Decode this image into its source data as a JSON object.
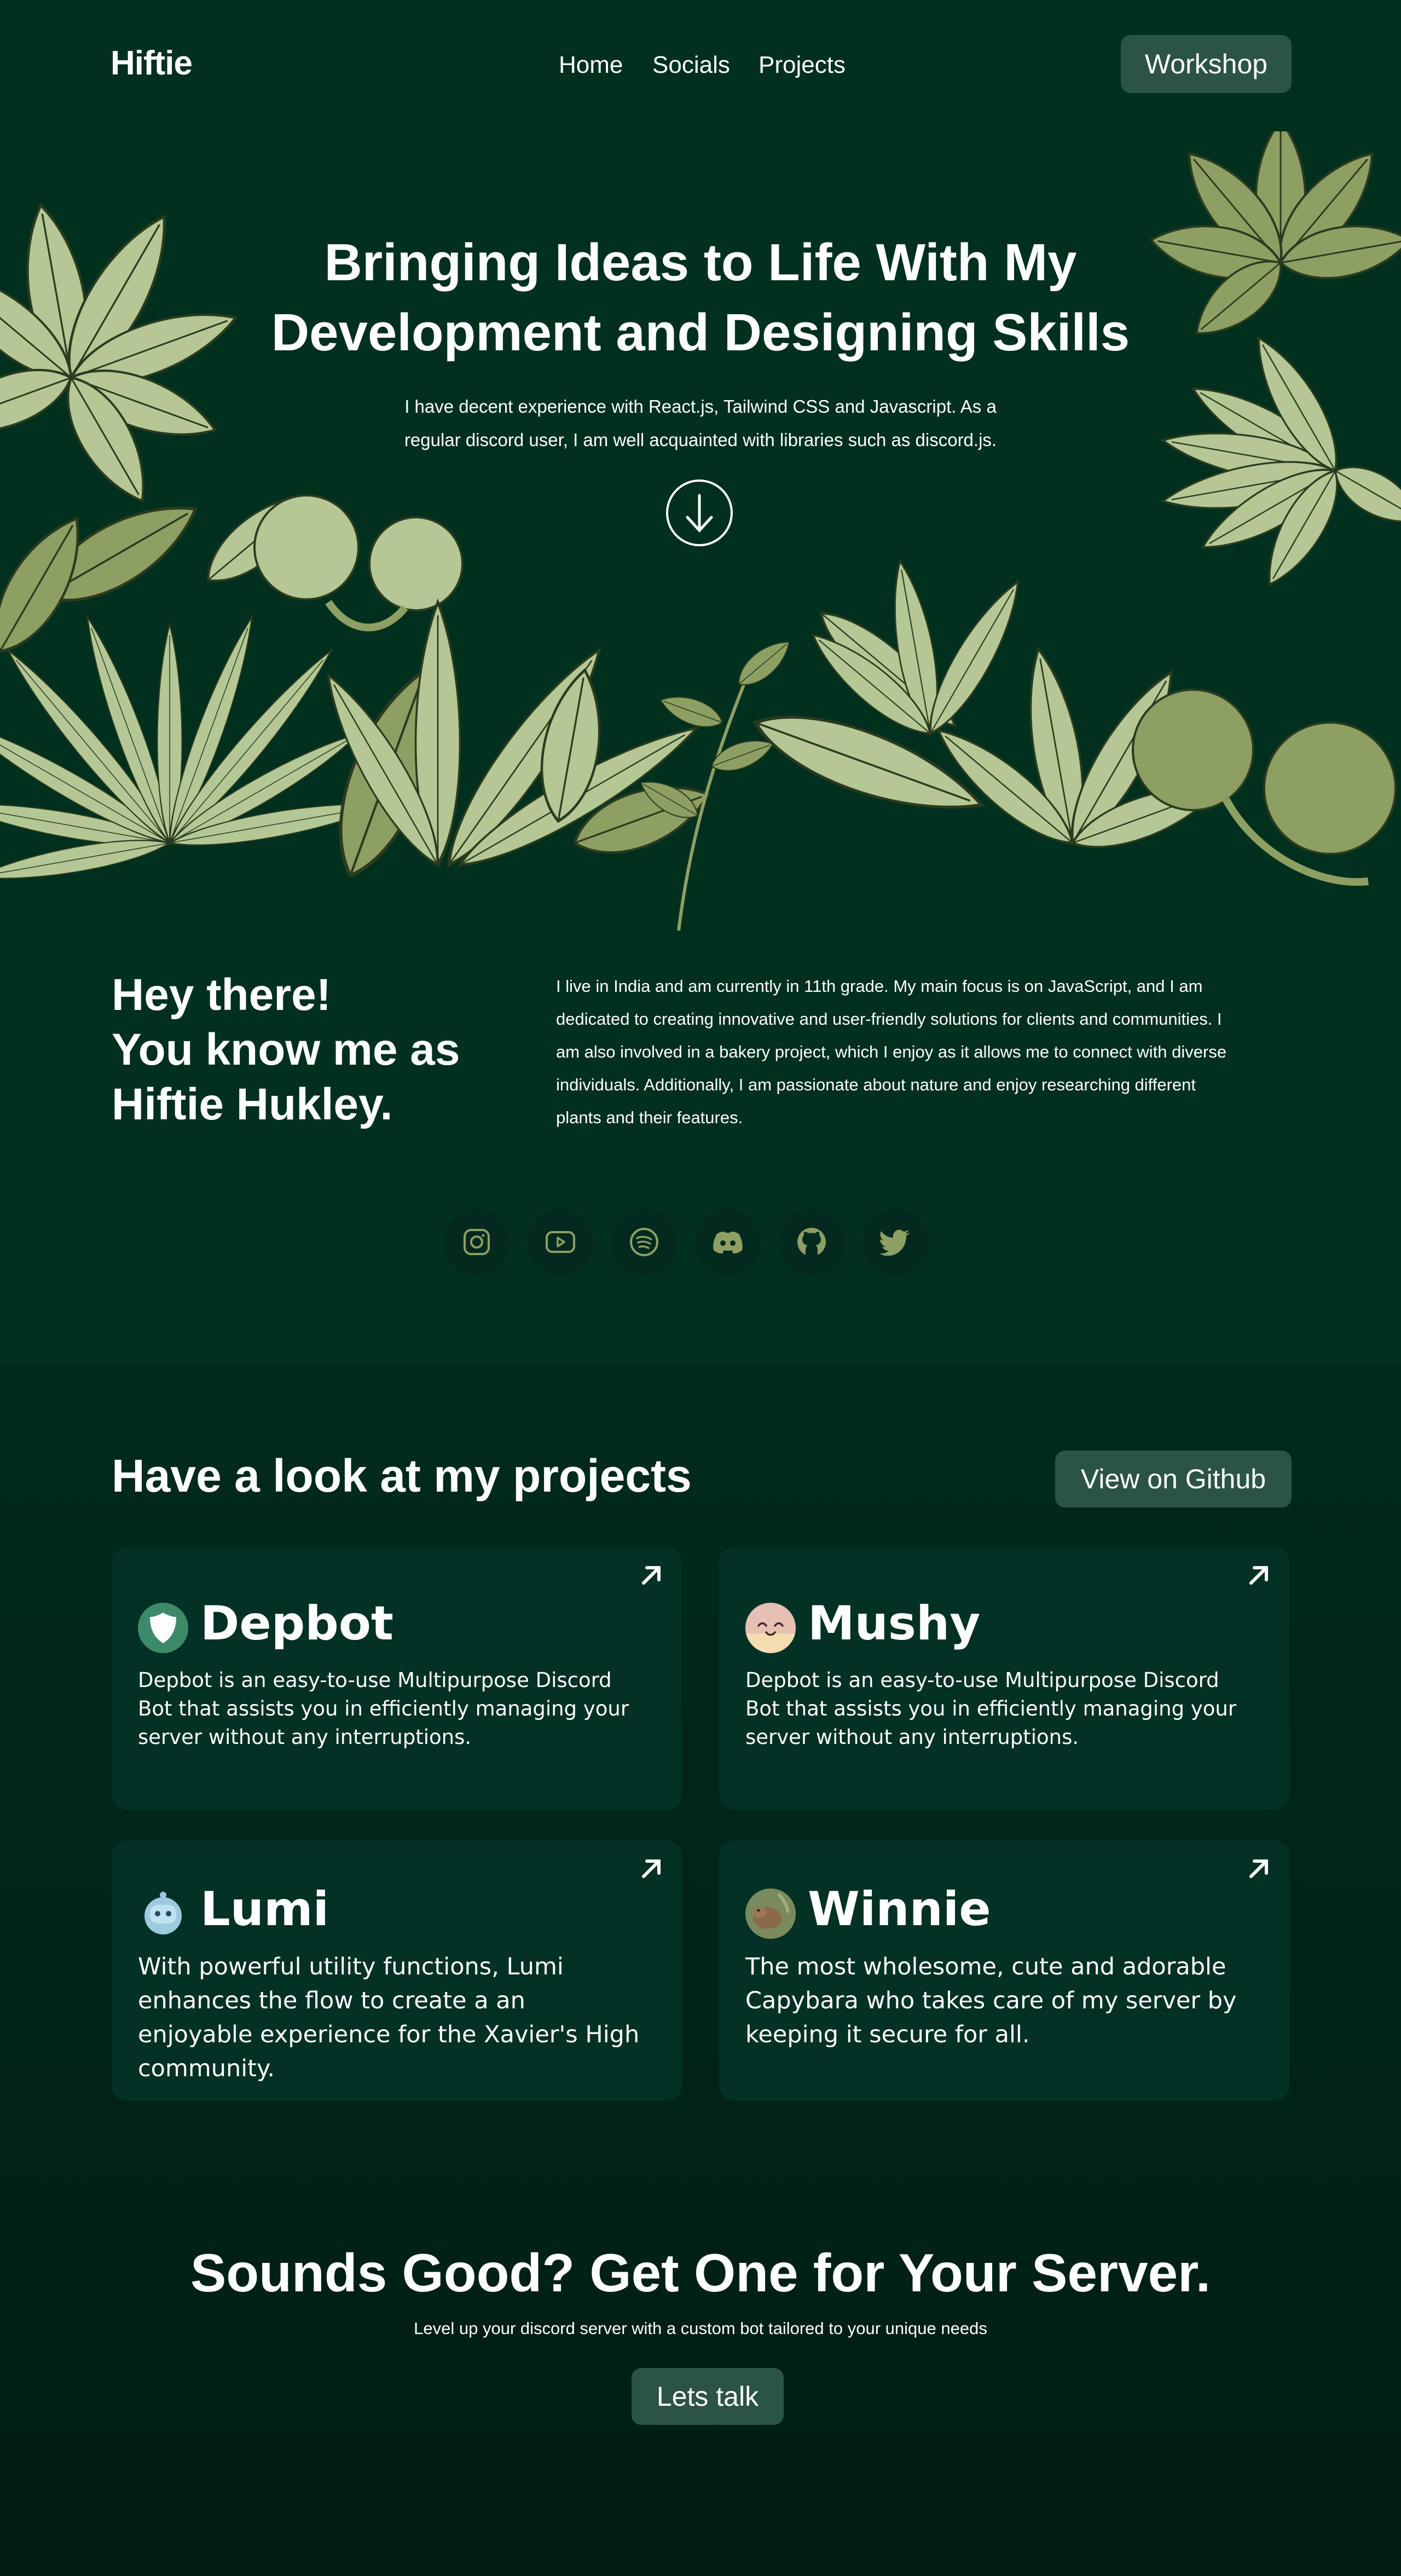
{
  "nav": {
    "logo": "Hiftie",
    "links": [
      "Home",
      "Socials",
      "Projects"
    ],
    "workshop_label": "Workshop"
  },
  "hero": {
    "title_line1": "Bringing Ideas to Life With My",
    "title_line2": "Development and Designing Skills",
    "subtitle_line1": "I have decent experience with React.js, Tailwind CSS and Javascript. As a",
    "subtitle_line2": "regular discord user, I am well acquainted with libraries such as discord.js.",
    "scroll_icon": "arrow-down-circle-icon"
  },
  "about": {
    "heading_line1": "Hey there!",
    "heading_line2": "You know me as",
    "heading_line3": "Hiftie Hukley.",
    "text_lines": [
      "I live in India and am currently in 11th grade. My main focus is on JavaScript, and I am",
      "dedicated to creating innovative and user-friendly solutions for clients and communities. I",
      "am also involved in a bakery project, which I enjoy as it allows me to connect with diverse",
      "individuals. Additionally, I am passionate about nature and enjoy researching different",
      "plants and their features."
    ],
    "socials": [
      "instagram-icon",
      "youtube-icon",
      "spotify-icon",
      "discord-icon",
      "github-icon",
      "twitter-icon"
    ]
  },
  "projects": {
    "heading": "Have a look at my projects",
    "github_label": "View on Github",
    "cards": [
      {
        "name": "Depbot",
        "desc": "Depbot is an easy-to-use Multipurpose Discord Bot that assists you in efficiently managing your server without any interruptions."
      },
      {
        "name": "Mushy",
        "desc": "Depbot is an easy-to-use Multipurpose Discord Bot that assists you in efficiently managing your server without any interruptions."
      },
      {
        "name": "Lumi",
        "desc": "With powerful utility functions, Lumi enhances the flow to create a an enjoyable experience for the Xavier's High community."
      },
      {
        "name": "Winnie",
        "desc": "The most wholesome, cute and adorable Capybara who takes care of my server by keeping it secure for all."
      }
    ]
  },
  "cta": {
    "title": "Sounds Good? Get One for Your Server.",
    "subtitle": "Level up your discord server with a custom bot tailored to your unique needs",
    "button_label": "Lets talk"
  },
  "colors": {
    "background": "#01301f",
    "card": "#033125",
    "button": "#2c5444",
    "leaf_light": "#b4c795",
    "leaf_dark": "#8d9f63",
    "social_icon": "#8d9f63"
  }
}
